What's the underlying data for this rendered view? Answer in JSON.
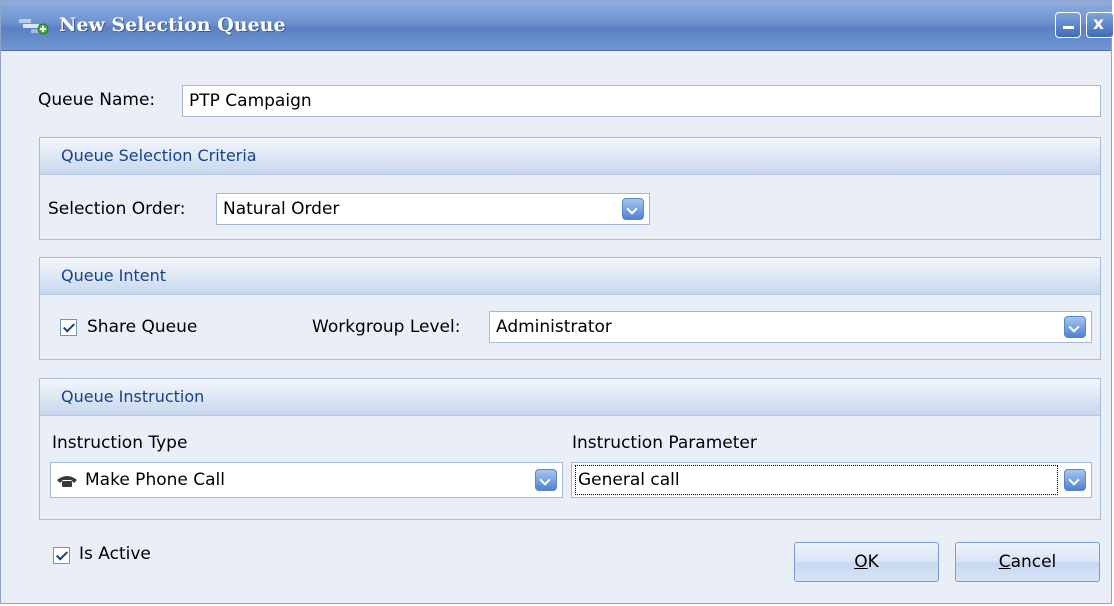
{
  "window": {
    "title": "New Selection Queue",
    "minimize_label": "_",
    "close_label": "x"
  },
  "queue_name": {
    "label": "Queue Name:",
    "value": "PTP Campaign"
  },
  "criteria": {
    "header": "Queue Selection Criteria",
    "selection_order_label": "Selection Order:",
    "selection_order_value": "Natural Order"
  },
  "intent": {
    "header": "Queue Intent",
    "share_queue_label": "Share Queue",
    "share_queue_checked": true,
    "workgroup_level_label": "Workgroup Level:",
    "workgroup_level_value": "Administrator"
  },
  "instruction": {
    "header": "Queue Instruction",
    "type_label": "Instruction Type",
    "type_value": "Make Phone Call",
    "type_icon": "phone-icon",
    "parameter_label": "Instruction Parameter",
    "parameter_value": "General call"
  },
  "footer": {
    "is_active_label": "Is Active",
    "is_active_checked": true,
    "ok_mnemonic": "O",
    "ok_rest": "K",
    "cancel_mnemonic": "C",
    "cancel_rest": "ancel"
  },
  "colors": {
    "accent": "#15428b",
    "titlebar": "#6e92cf"
  }
}
